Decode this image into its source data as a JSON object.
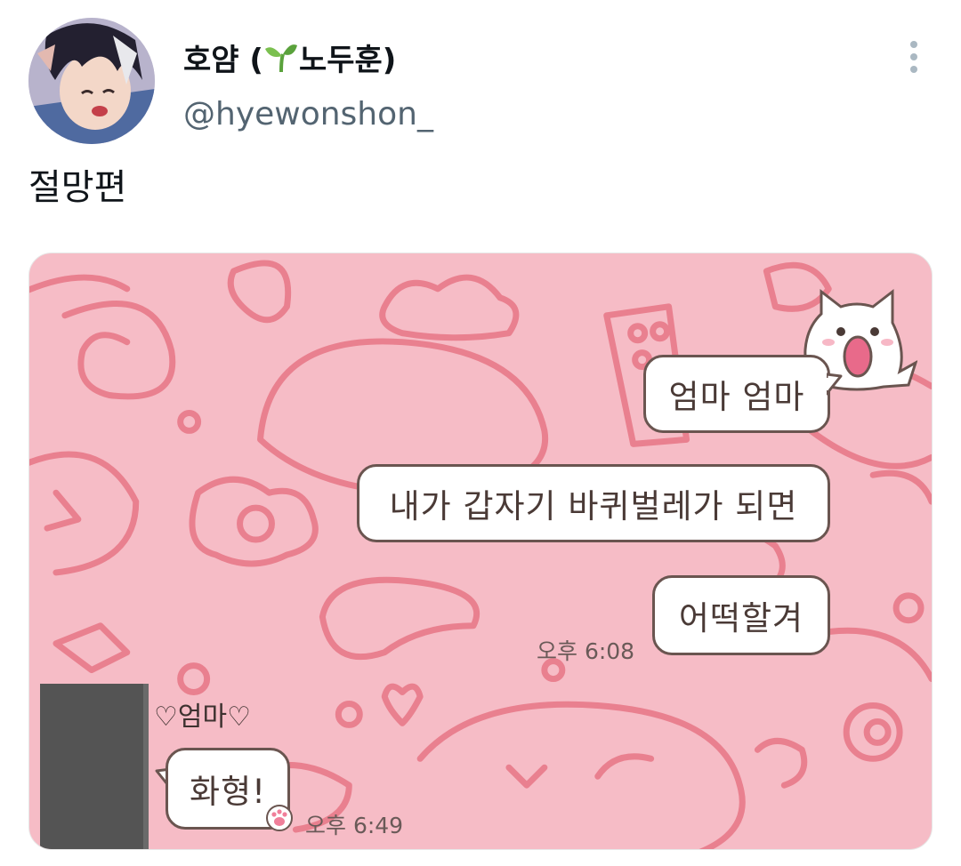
{
  "tweet": {
    "display_name_pre": "호얌 (",
    "display_name_post": "노두훈)",
    "handle": "@hyewonshon_",
    "text": "절망편",
    "icons": {
      "more": "more-vertical-icon",
      "sprout": "sprout-emoji-icon"
    }
  },
  "chat": {
    "messages_out": [
      {
        "text": "엄마 엄마"
      },
      {
        "text": "내가 갑자기 바퀴벌레가 되면"
      },
      {
        "text": "어떡할겨"
      }
    ],
    "time_out": "오후 6:08",
    "sender_name": "♡엄마♡",
    "message_in": "화형!",
    "time_in": "오후 6:49"
  },
  "colors": {
    "chat_background": "#f6bcc6",
    "doodle": "#e9808f",
    "bubble_border": "#6a5550"
  }
}
